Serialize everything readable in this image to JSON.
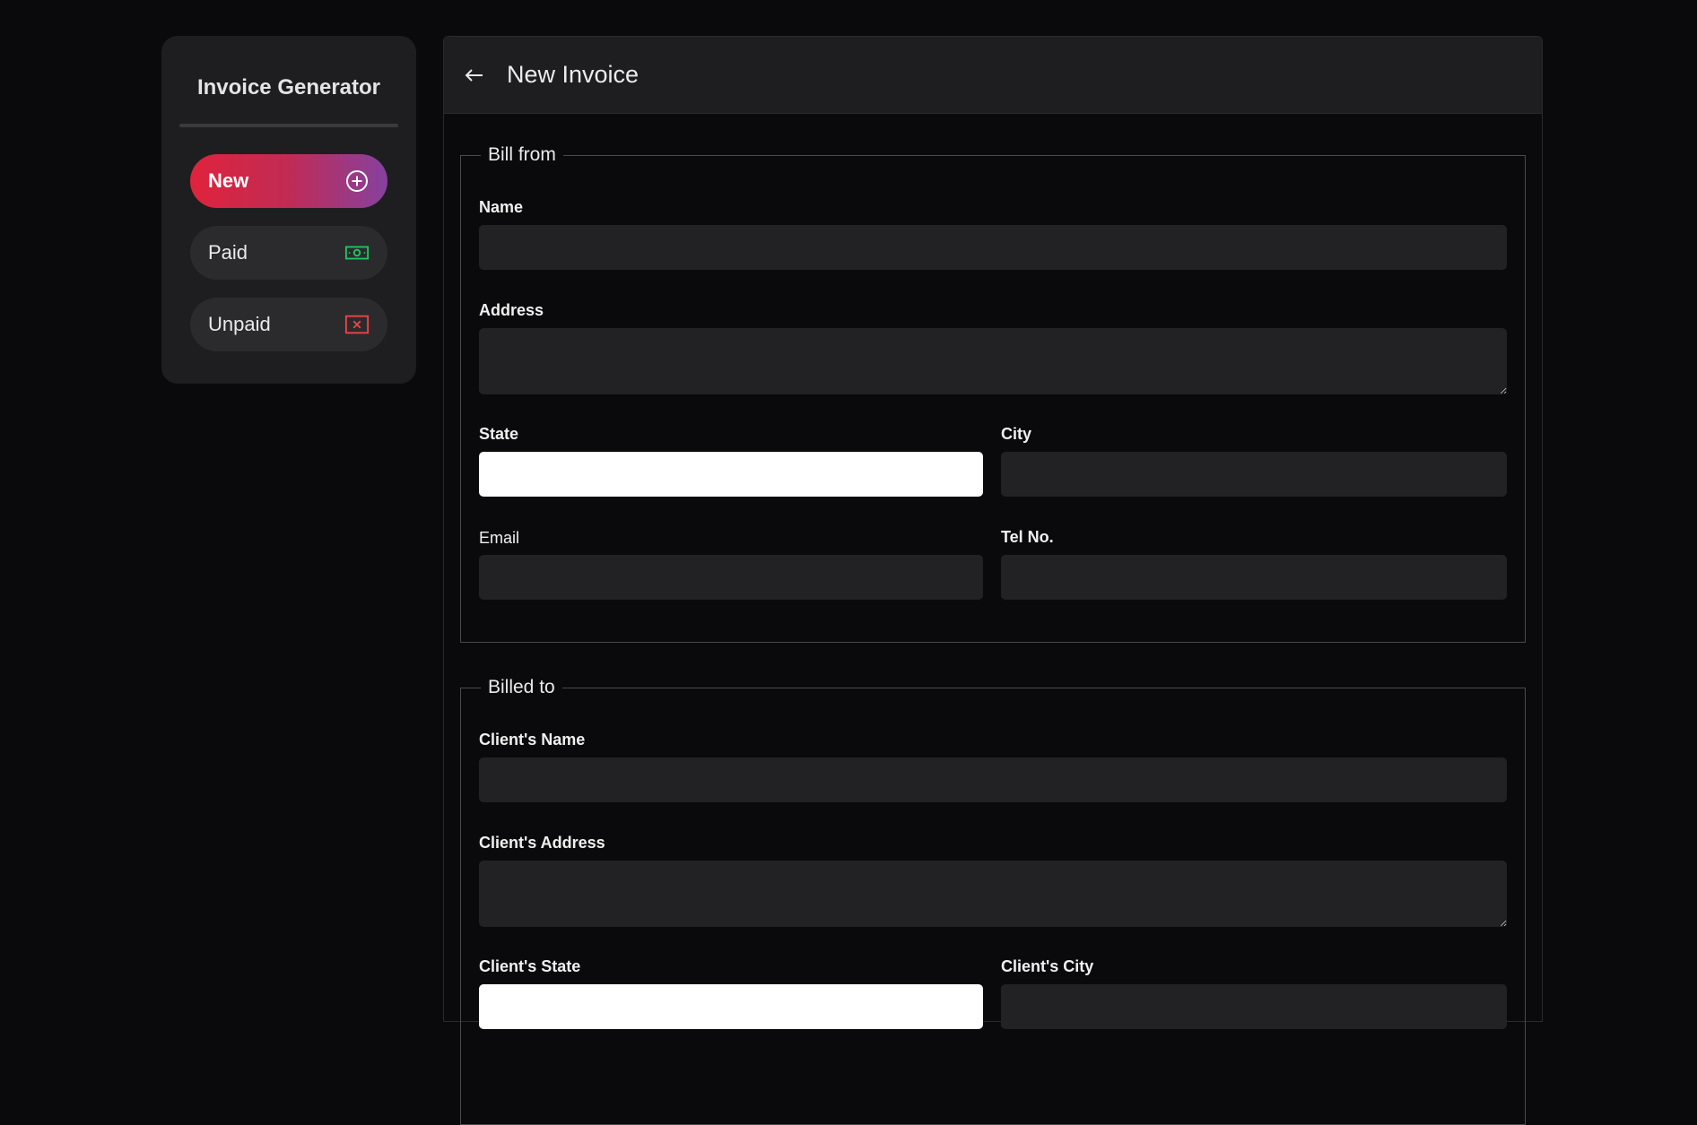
{
  "sidebar": {
    "title": "Invoice Generator",
    "items": [
      {
        "label": "New",
        "icon": "plus-circle-icon",
        "icon_color": "#ffffff"
      },
      {
        "label": "Paid",
        "icon": "cash-icon",
        "icon_color": "#22c55e"
      },
      {
        "label": "Unpaid",
        "icon": "x-square-icon",
        "icon_color": "#ef4444"
      }
    ]
  },
  "header": {
    "back_icon": "arrow-left-icon",
    "title": "New Invoice"
  },
  "bill_from": {
    "legend": "Bill from",
    "name_label": "Name",
    "address_label": "Address",
    "state_label": "State",
    "city_label": "City",
    "email_label": "Email",
    "tel_label": "Tel No."
  },
  "billed_to": {
    "legend": "Billed to",
    "name_label": "Client's Name",
    "address_label": "Client's Address",
    "state_label": "Client's State",
    "city_label": "Client's City"
  },
  "colors": {
    "accent_gradient_start": "#e0233c",
    "accent_gradient_end": "#86419f",
    "background": "#0a0a0c",
    "panel": "#1e1e20"
  }
}
